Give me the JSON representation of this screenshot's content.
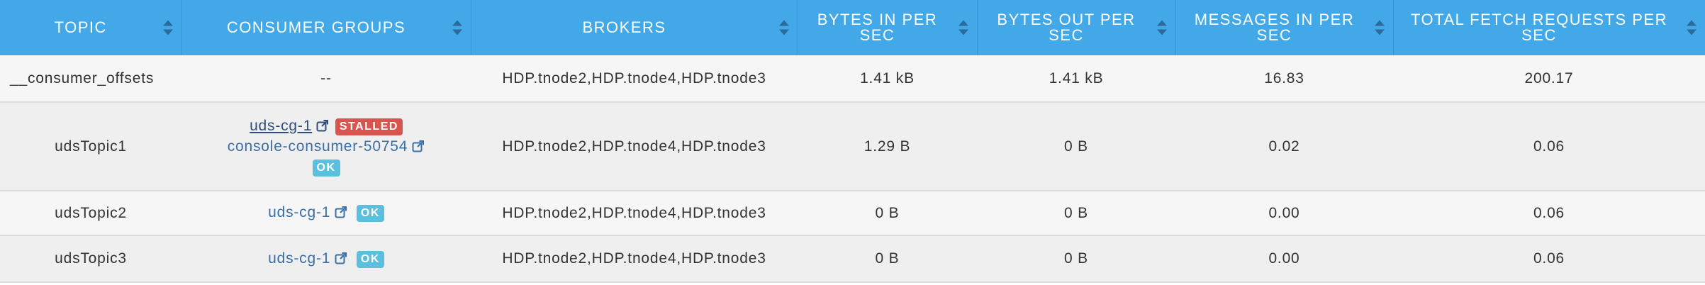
{
  "columns": [
    "TOPIC",
    "CONSUMER GROUPS",
    "BROKERS",
    "BYTES IN PER SEC",
    "BYTES OUT PER SEC",
    "MESSAGES IN PER SEC",
    "TOTAL FETCH REQUESTS PER SEC"
  ],
  "rows": [
    {
      "topic": "__consumer_offsets",
      "consumer_groups": [
        {
          "text": "--"
        }
      ],
      "brokers": "HDP.tnode2,HDP.tnode4,HDP.tnode3",
      "bytes_in": "1.41 kB",
      "bytes_out": "1.41 kB",
      "messages_in": "16.83",
      "fetch_requests": "200.17"
    },
    {
      "topic": "udsTopic1",
      "consumer_groups": [
        {
          "name": "uds-cg-1",
          "status": "STALLED"
        },
        {
          "name": "console-consumer-50754",
          "status": "OK"
        }
      ],
      "brokers": "HDP.tnode2,HDP.tnode4,HDP.tnode3",
      "bytes_in": "1.29 B",
      "bytes_out": "0 B",
      "messages_in": "0.02",
      "fetch_requests": "0.06"
    },
    {
      "topic": "udsTopic2",
      "consumer_groups": [
        {
          "name": "uds-cg-1",
          "status": "OK"
        }
      ],
      "brokers": "HDP.tnode2,HDP.tnode4,HDP.tnode3",
      "bytes_in": "0 B",
      "bytes_out": "0 B",
      "messages_in": "0.00",
      "fetch_requests": "0.06"
    },
    {
      "topic": "udsTopic3",
      "consumer_groups": [
        {
          "name": "uds-cg-1",
          "status": "OK"
        }
      ],
      "brokers": "HDP.tnode2,HDP.tnode4,HDP.tnode3",
      "bytes_in": "0 B",
      "bytes_out": "0 B",
      "messages_in": "0.00",
      "fetch_requests": "0.06"
    }
  ],
  "icons": {
    "sort": "sort-icon",
    "external_link": "external-link-icon"
  },
  "colors": {
    "header_bg": "#43a8e8",
    "stalled_badge": "#d9534f",
    "ok_badge": "#5bc0de",
    "link": "#3a6fa8"
  }
}
